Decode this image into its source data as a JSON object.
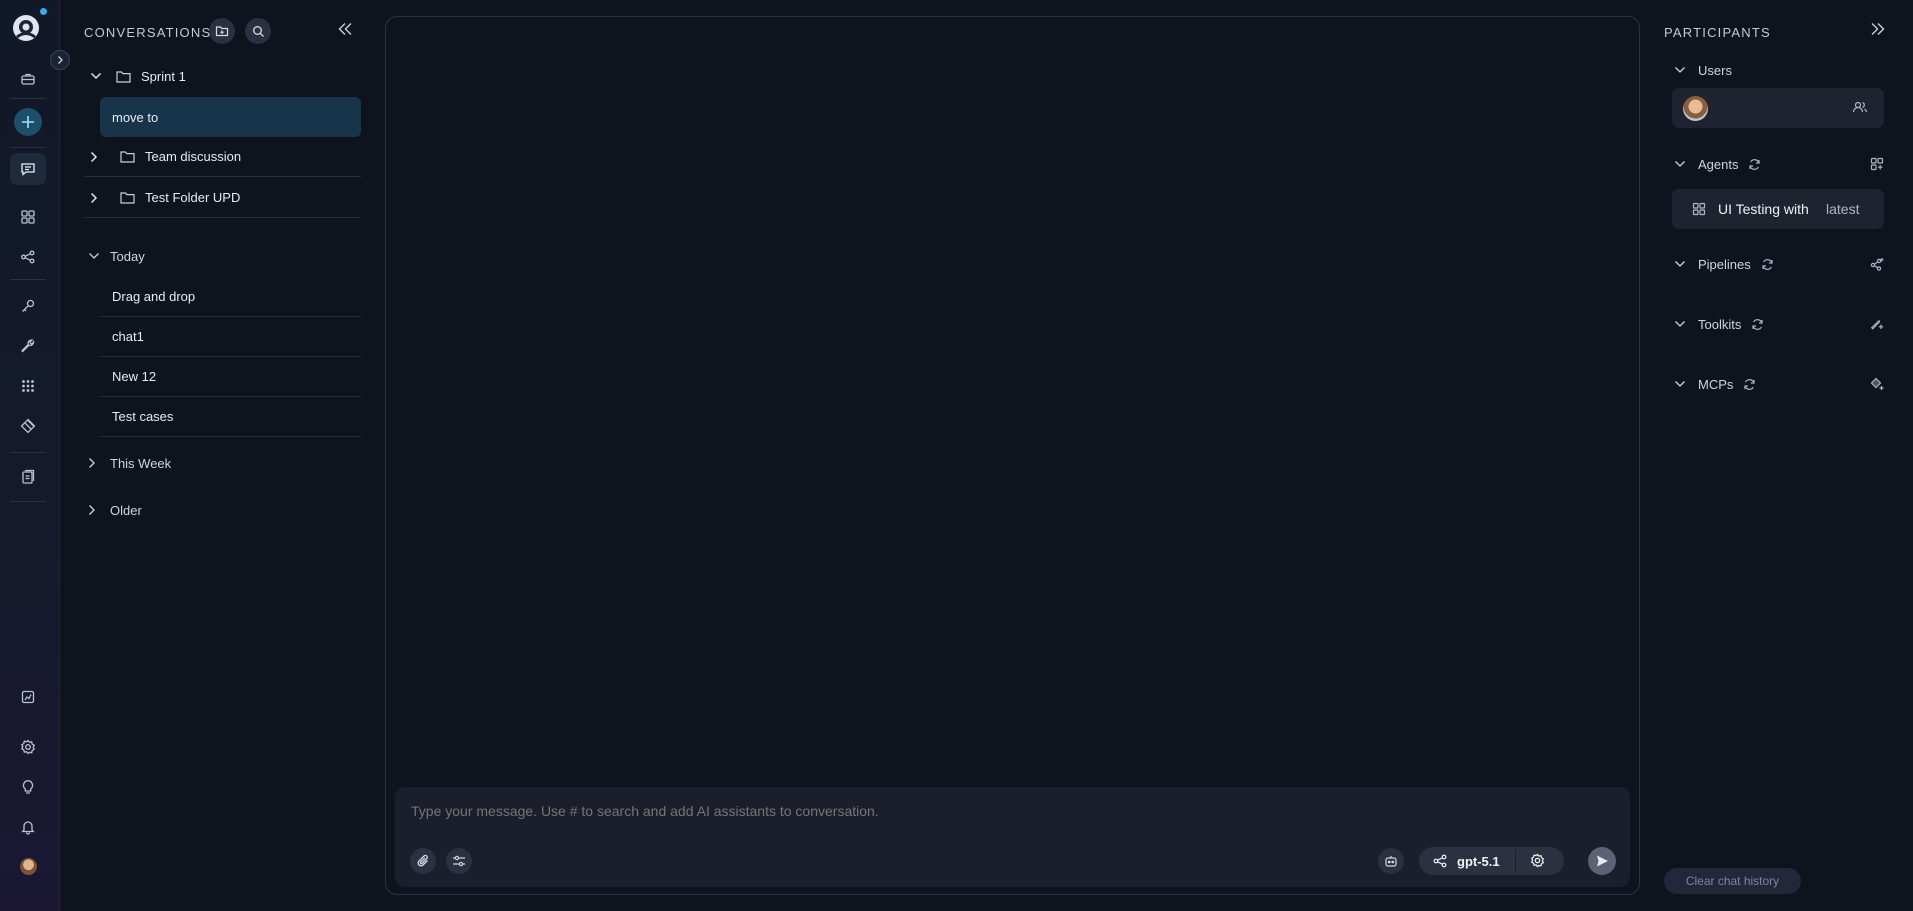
{
  "colors": {
    "background": "#0e131d",
    "selected_item": "#17344a",
    "accent": "#3ba8e8",
    "composer": "#1b1f2b"
  },
  "rail": {
    "icons": [
      "app-logo-icon",
      "briefcase-icon",
      "plus-icon",
      "chat-icon",
      "grid-icon",
      "pipeline-icon",
      "key-icon",
      "wrench-icon",
      "apps-icon",
      "diamond-icon",
      "document-icon",
      "feedback-icon",
      "settings-icon",
      "lightbulb-icon",
      "bell-icon",
      "avatar"
    ],
    "active": "chat-icon"
  },
  "conversations": {
    "title": "CONVERSATIONS",
    "folders": [
      {
        "label": "Sprint 1",
        "expanded": true,
        "items": [
          "move to"
        ]
      },
      {
        "label": "Team discussion",
        "expanded": false,
        "items": []
      },
      {
        "label": "Test Folder UPD",
        "expanded": false,
        "items": []
      }
    ],
    "selected": "move to",
    "groups": [
      {
        "label": "Today",
        "expanded": true,
        "items": [
          "Drag and drop",
          "chat1",
          "New 12",
          "Test cases"
        ]
      },
      {
        "label": "This Week",
        "expanded": false,
        "items": []
      },
      {
        "label": "Older",
        "expanded": false,
        "items": []
      }
    ]
  },
  "composer": {
    "placeholder": "Type your message. Use # to search and add AI assistants to conversation.",
    "model": "gpt-5.1"
  },
  "participants": {
    "title": "PARTICIPANTS",
    "sections": {
      "users": "Users",
      "agents": "Agents",
      "pipelines": "Pipelines",
      "toolkits": "Toolkits",
      "mcps": "MCPs"
    },
    "agent": {
      "name": "UI Testing with",
      "version": "latest"
    },
    "clear_label": "Clear chat history"
  }
}
